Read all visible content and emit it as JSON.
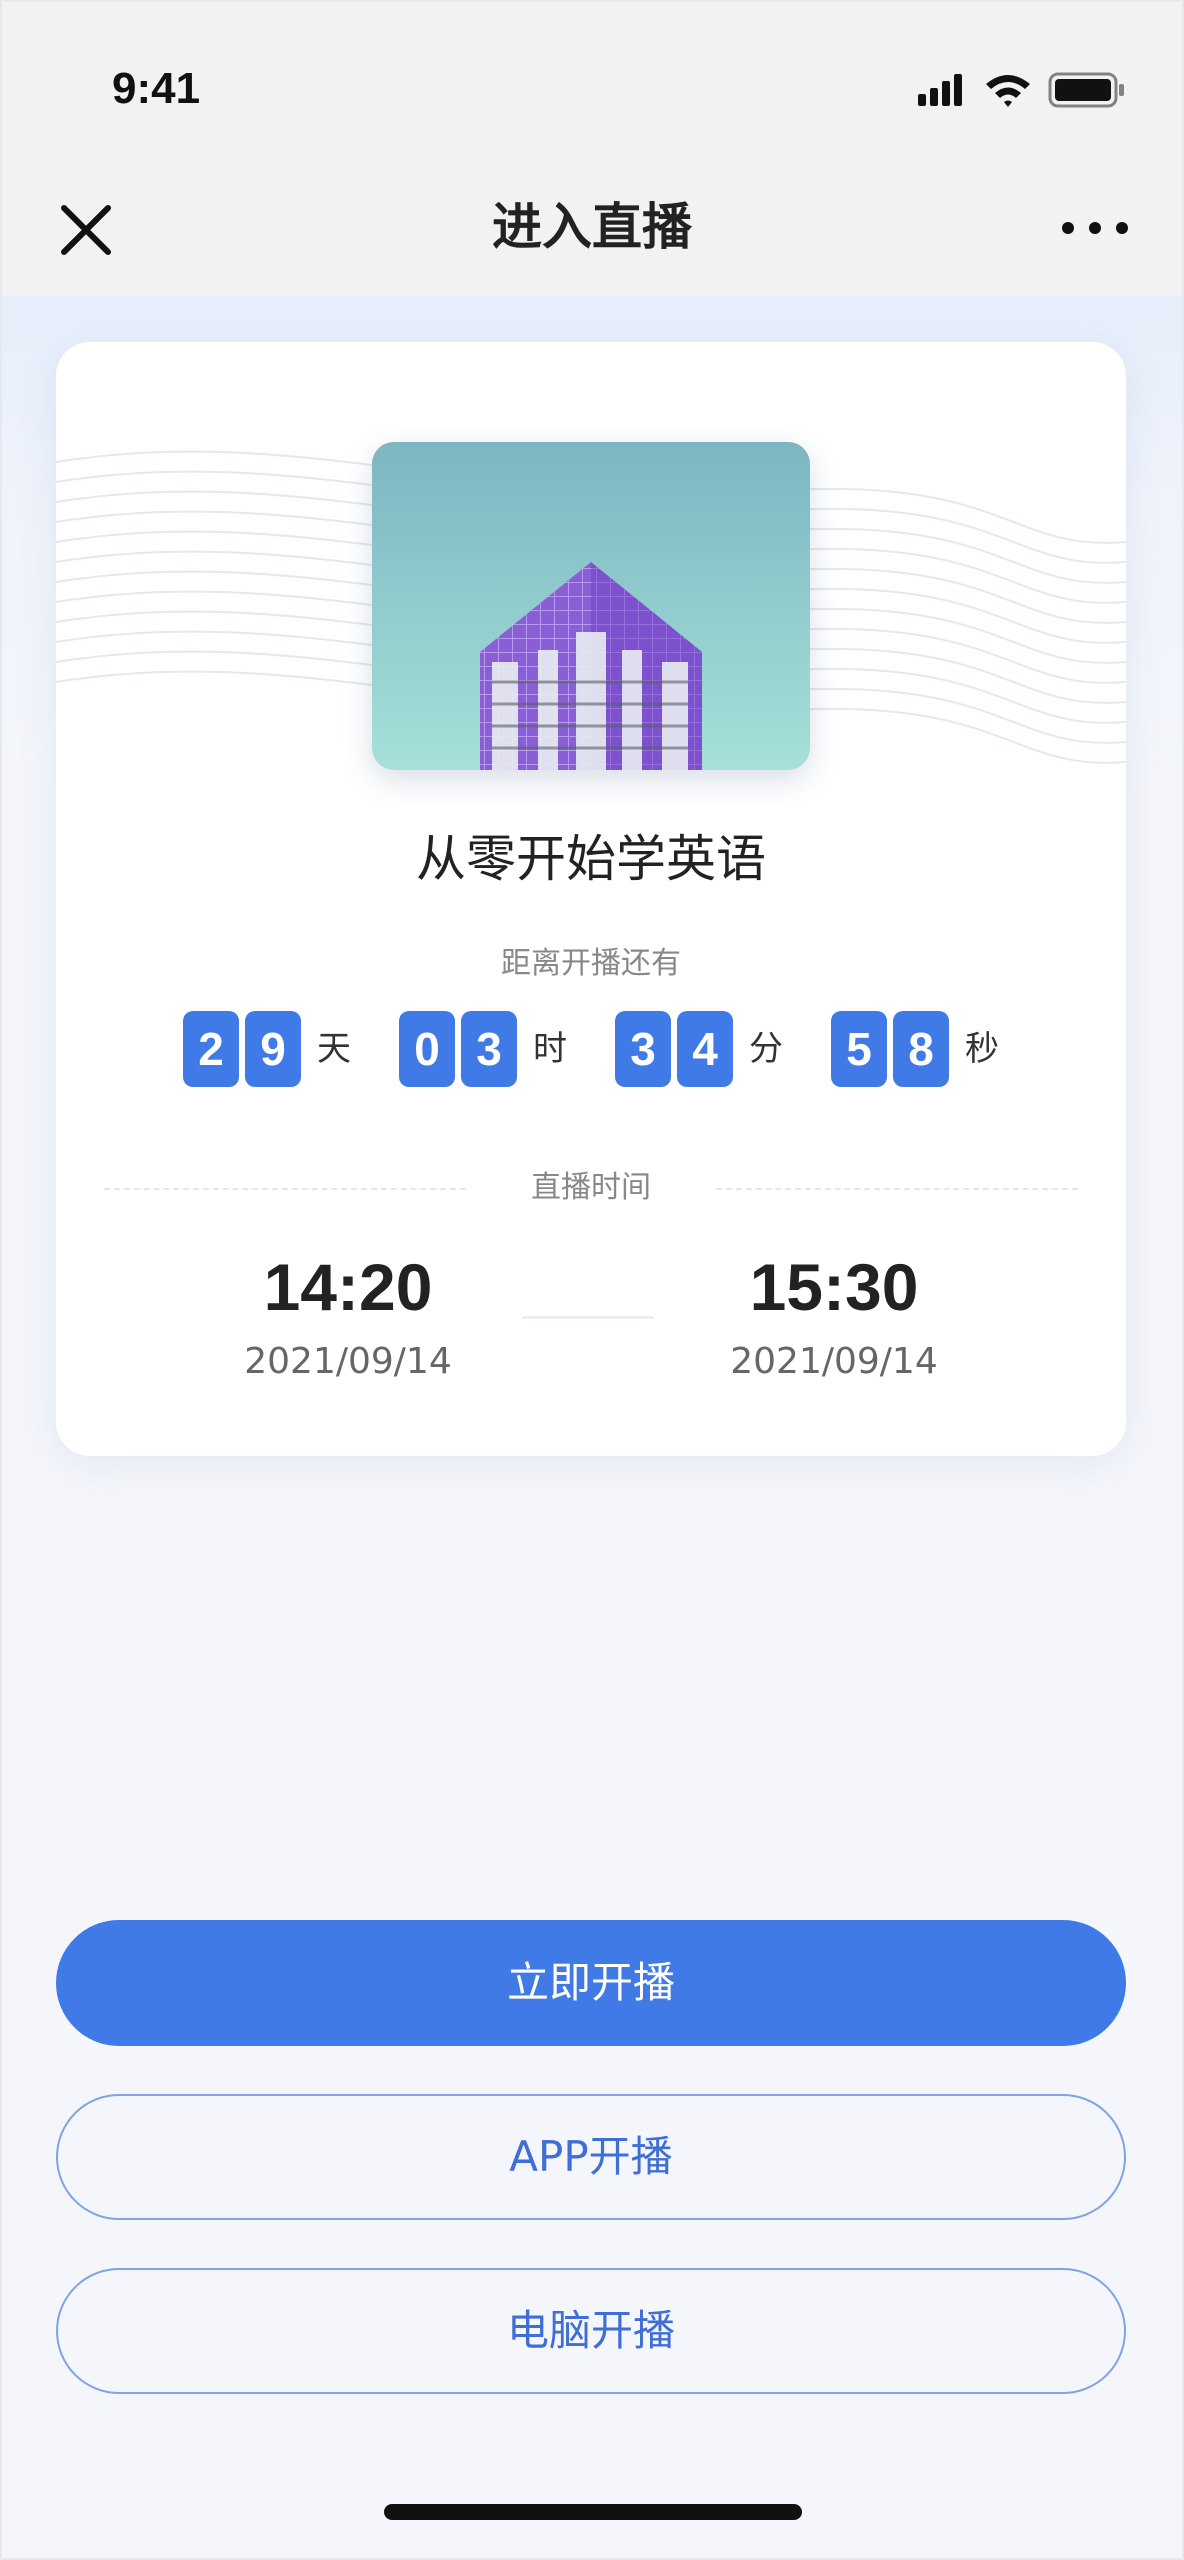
{
  "status_bar": {
    "time": "9:41"
  },
  "nav": {
    "title": "进入直播"
  },
  "course": {
    "title": "从零开始学英语"
  },
  "countdown": {
    "label": "距离开播还有",
    "days": [
      "2",
      "9"
    ],
    "days_unit": "天",
    "hours": [
      "0",
      "3"
    ],
    "hours_unit": "时",
    "minutes": [
      "3",
      "4"
    ],
    "minutes_unit": "分",
    "seconds": [
      "5",
      "8"
    ],
    "seconds_unit": "秒"
  },
  "live_time": {
    "label": "直播时间",
    "start_time": "14:20",
    "start_date": "2021/09/14",
    "end_time": "15:30",
    "end_date": "2021/09/14"
  },
  "buttons": {
    "start_now": "立即开播",
    "app_start": "APP开播",
    "pc_start": "电脑开播"
  },
  "colors": {
    "accent": "#3f7ae6",
    "outline": "#7fa3e6"
  }
}
